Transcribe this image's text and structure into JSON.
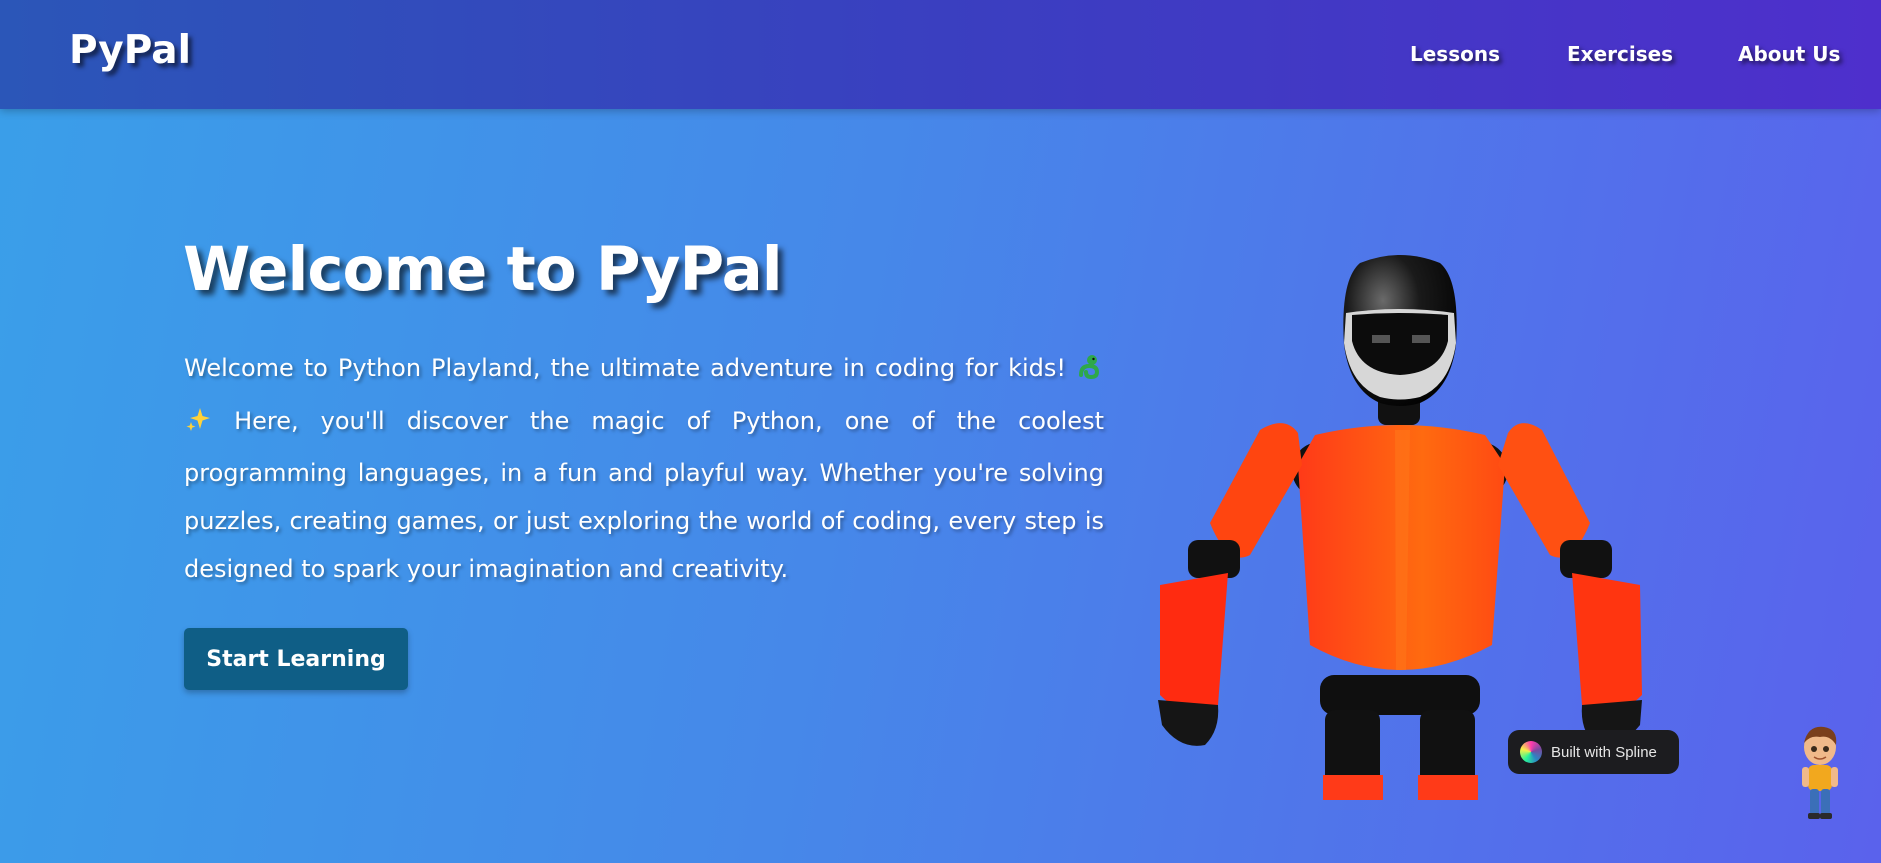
{
  "header": {
    "logo": "PyPal",
    "nav": [
      "Lessons",
      "Exercises",
      "About Us"
    ]
  },
  "hero": {
    "title": "Welcome to PyPal",
    "intro_before_icons": "Welcome to Python Playland, the ultimate adventure in coding for kids!",
    "icons": [
      "snake-icon",
      "sparkles-icon"
    ],
    "intro_after_icons": "Here, you'll discover the magic of Python, one of the coolest programming languages, in a fun and playful way. Whether you're solving puzzles, creating games, or just exploring the world of coding, every step is designed to spark your imagination and creativity.",
    "cta_label": "Start Learning"
  },
  "badge": {
    "label": "Built with Spline"
  },
  "colors": {
    "nav_start": "#2b56b8",
    "nav_end": "#4e2fcc",
    "hero_start": "#3a9fe9",
    "hero_end": "#5a62ec",
    "cta": "#0f5e86",
    "robot_orange": "#ff5a14"
  }
}
